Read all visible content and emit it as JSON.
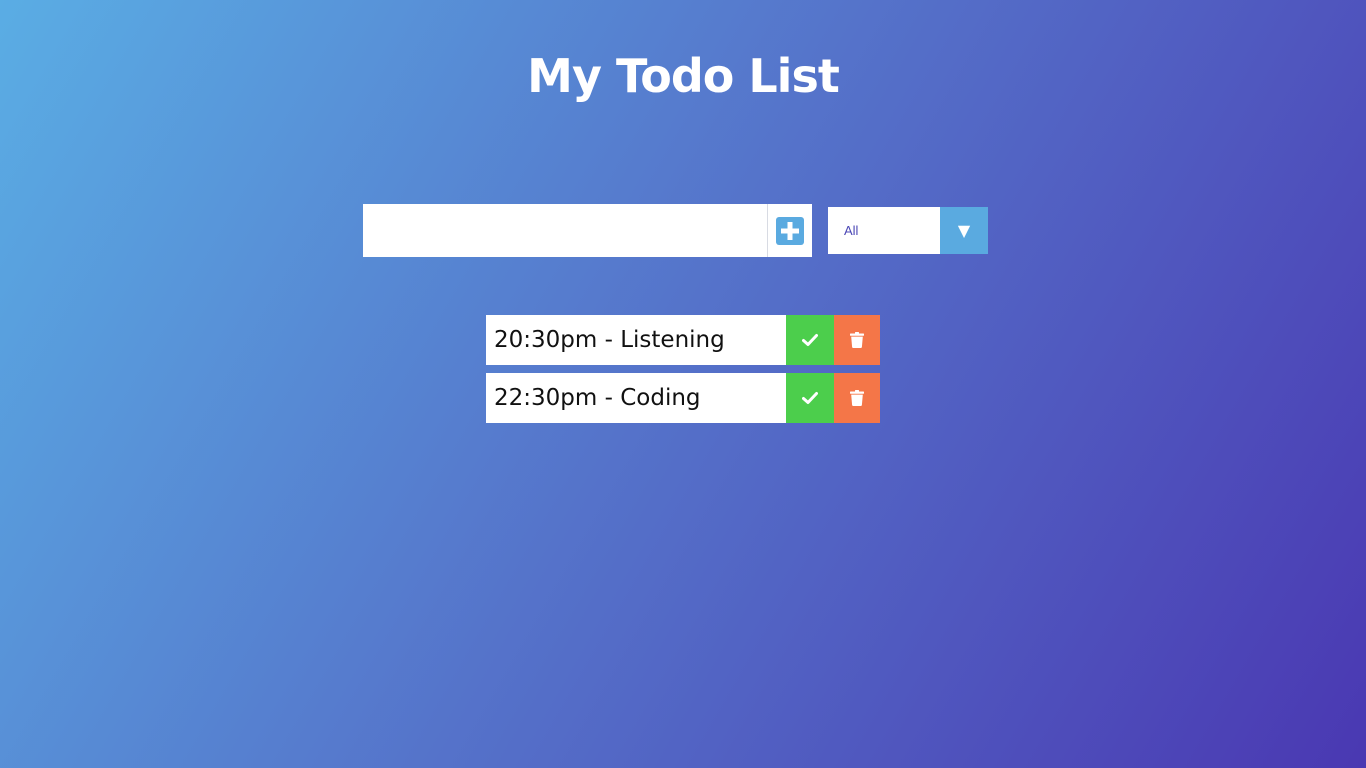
{
  "app": {
    "title": "My Todo List"
  },
  "form": {
    "input_value": "",
    "add_icon": "plus-square-icon"
  },
  "filter": {
    "selected": "All",
    "arrow_glyph": "▼"
  },
  "todos": [
    {
      "text": "20:30pm - Listening"
    },
    {
      "text": "22:30pm - Coding"
    }
  ],
  "colors": {
    "gradient_start": "#5aade4",
    "gradient_end": "#4a38b2",
    "accent_blue": "#5aaae0",
    "complete_green": "#4cce4c",
    "delete_orange": "#f47648",
    "filter_text": "#4b47b5"
  }
}
